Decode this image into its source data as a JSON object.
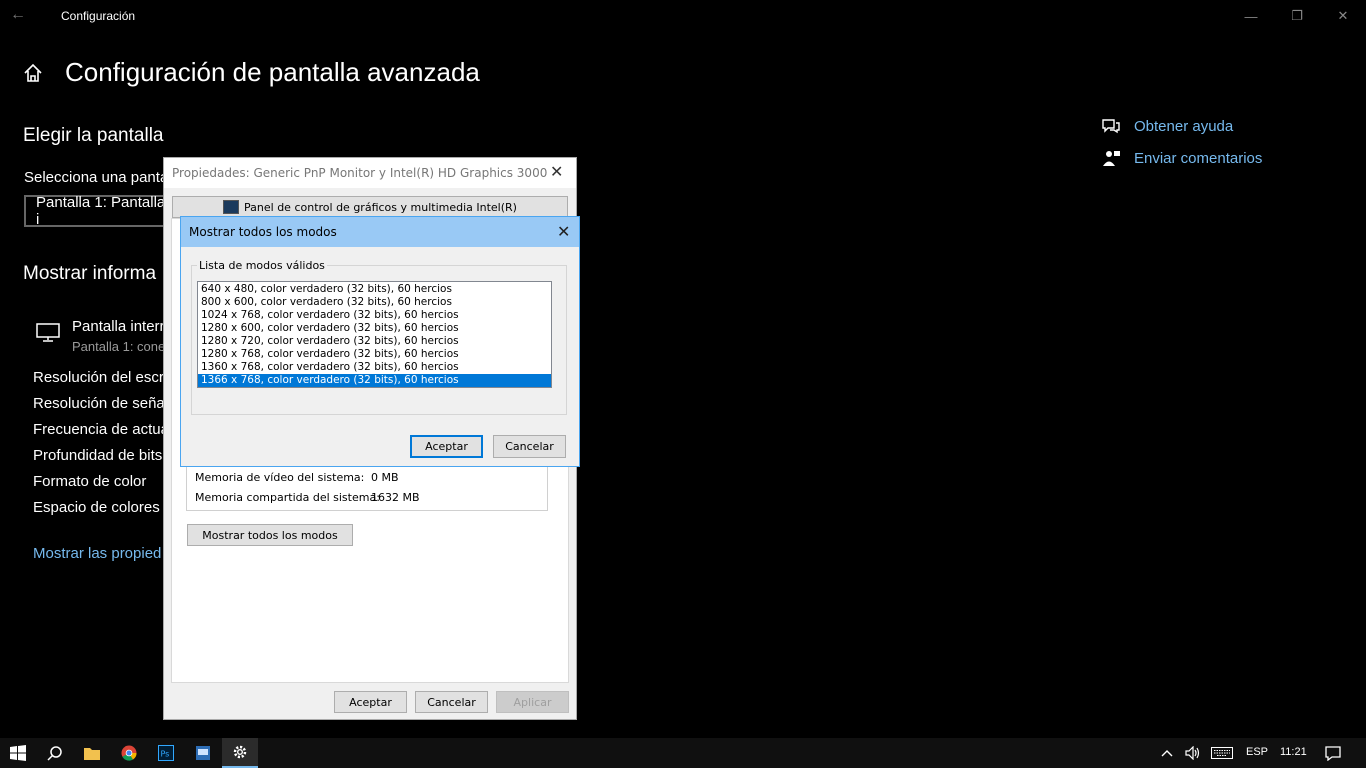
{
  "window": {
    "title": "Configuración",
    "back_glyph": "←",
    "minimize_glyph": "—",
    "maximize_glyph": "❐",
    "close_glyph": "✕"
  },
  "page": {
    "title": "Configuración de pantalla avanzada",
    "choose_display_heading": "Elegir la pantalla",
    "select_display_label": "Selecciona una panta",
    "display_dropdown_value": "Pantalla 1: Pantalla i",
    "show_info_heading": "Mostrar informa",
    "monitor_name": "Pantalla interr",
    "monitor_sub": "Pantalla 1: conec",
    "info_rows": [
      "Resolución del escri",
      "Resolución de señal",
      "Frecuencia de actua",
      "Profundidad de bits",
      "Formato de color",
      "Espacio de colores"
    ],
    "properties_link": "Mostrar las propied"
  },
  "help": {
    "get_help": "Obtener ayuda",
    "feedback": "Enviar comentarios"
  },
  "properties_dialog": {
    "title": "Propiedades: Generic PnP Monitor y Intel(R) HD Graphics 3000",
    "intel_tab": "Panel de control de gráficos y multimedia Intel(R)",
    "memory_rows": [
      {
        "label": "Memoria de vídeo del sistema:",
        "value": "0 MB"
      },
      {
        "label": "Memoria compartida del sistema:",
        "value": "1632 MB"
      }
    ],
    "show_modes_button": "Mostrar todos los modos",
    "ok": "Aceptar",
    "cancel": "Cancelar",
    "apply": "Aplicar"
  },
  "modes_dialog": {
    "title": "Mostrar todos los modos",
    "group_label": "Lista de modos válidos",
    "modes": [
      "640 x 480, color verdadero (32 bits), 60 hercios",
      "800 x 600, color verdadero (32 bits), 60 hercios",
      "1024 x 768, color verdadero (32 bits), 60 hercios",
      "1280 x 600, color verdadero (32 bits), 60 hercios",
      "1280 x 720, color verdadero (32 bits), 60 hercios",
      "1280 x 768, color verdadero (32 bits), 60 hercios",
      "1360 x 768, color verdadero (32 bits), 60 hercios",
      "1366 x 768, color verdadero (32 bits), 60 hercios"
    ],
    "selected_index": 7,
    "ok": "Aceptar",
    "cancel": "Cancelar"
  },
  "taskbar": {
    "language": "ESP",
    "time": "11:21",
    "apps": [
      "start-icon",
      "search-icon",
      "file-explorer-icon",
      "chrome-icon",
      "photoshop-icon",
      "display-settings-app-icon",
      "settings-gear-icon"
    ]
  },
  "colors": {
    "accent": "#0078d7",
    "link": "#76b9ed",
    "background": "#000000"
  }
}
